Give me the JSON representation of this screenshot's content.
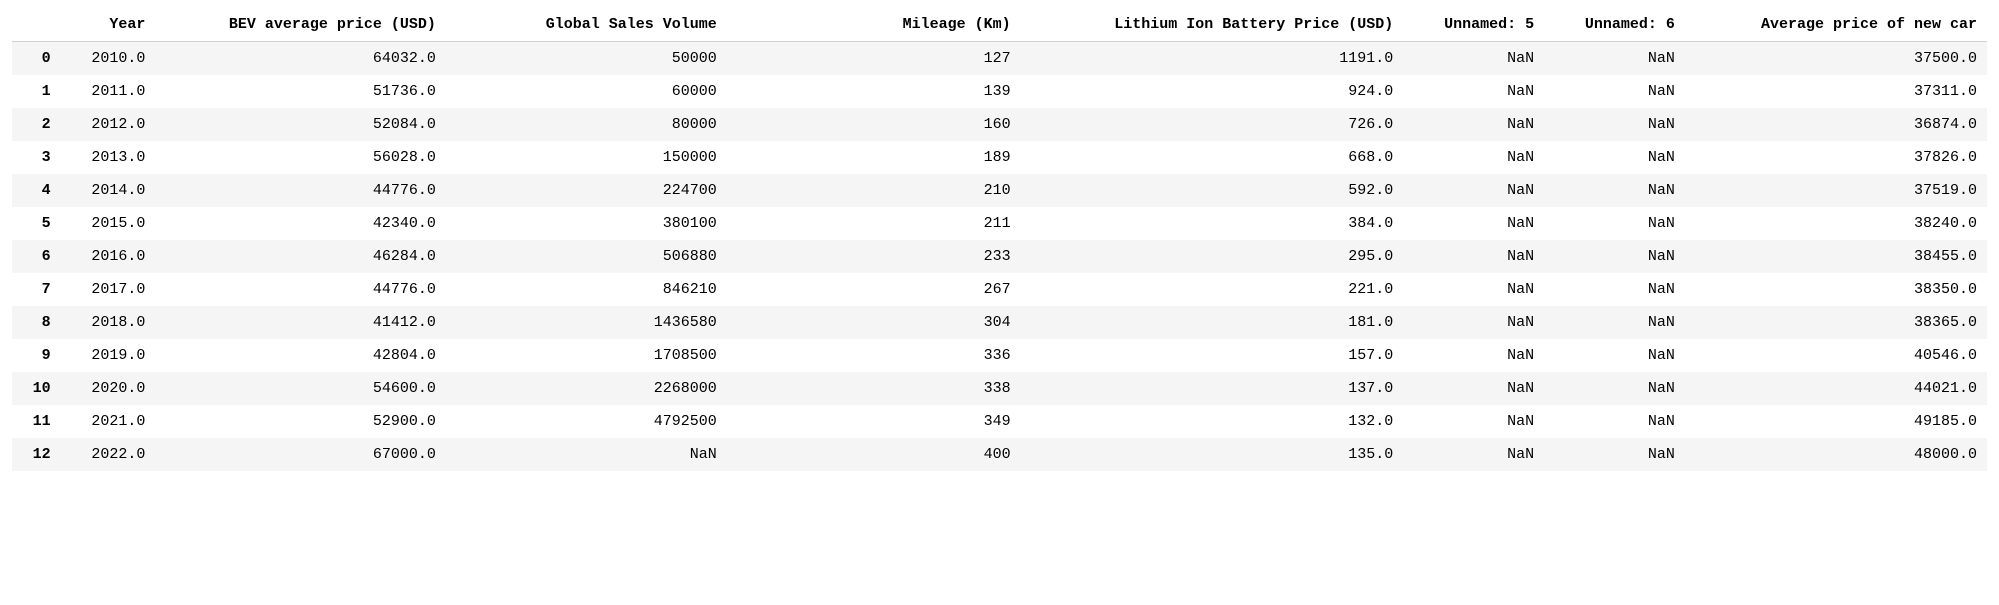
{
  "chart_data": {
    "type": "table",
    "columns": [
      "",
      "Year",
      "BEV average price (USD)",
      "Global Sales Volume",
      "Mileage (Km)",
      "Lithium Ion Battery Price (USD)",
      "Unnamed: 5",
      "Unnamed: 6",
      "Average price of new car"
    ],
    "rows": [
      [
        "0",
        "2010.0",
        "64032.0",
        "50000",
        "127",
        "1191.0",
        "NaN",
        "NaN",
        "37500.0"
      ],
      [
        "1",
        "2011.0",
        "51736.0",
        "60000",
        "139",
        "924.0",
        "NaN",
        "NaN",
        "37311.0"
      ],
      [
        "2",
        "2012.0",
        "52084.0",
        "80000",
        "160",
        "726.0",
        "NaN",
        "NaN",
        "36874.0"
      ],
      [
        "3",
        "2013.0",
        "56028.0",
        "150000",
        "189",
        "668.0",
        "NaN",
        "NaN",
        "37826.0"
      ],
      [
        "4",
        "2014.0",
        "44776.0",
        "224700",
        "210",
        "592.0",
        "NaN",
        "NaN",
        "37519.0"
      ],
      [
        "5",
        "2015.0",
        "42340.0",
        "380100",
        "211",
        "384.0",
        "NaN",
        "NaN",
        "38240.0"
      ],
      [
        "6",
        "2016.0",
        "46284.0",
        "506880",
        "233",
        "295.0",
        "NaN",
        "NaN",
        "38455.0"
      ],
      [
        "7",
        "2017.0",
        "44776.0",
        "846210",
        "267",
        "221.0",
        "NaN",
        "NaN",
        "38350.0"
      ],
      [
        "8",
        "2018.0",
        "41412.0",
        "1436580",
        "304",
        "181.0",
        "NaN",
        "NaN",
        "38365.0"
      ],
      [
        "9",
        "2019.0",
        "42804.0",
        "1708500",
        "336",
        "157.0",
        "NaN",
        "NaN",
        "40546.0"
      ],
      [
        "10",
        "2020.0",
        "54600.0",
        "2268000",
        "338",
        "137.0",
        "NaN",
        "NaN",
        "44021.0"
      ],
      [
        "11",
        "2021.0",
        "52900.0",
        "4792500",
        "349",
        "132.0",
        "NaN",
        "NaN",
        "49185.0"
      ],
      [
        "12",
        "2022.0",
        "67000.0",
        "NaN",
        "400",
        "135.0",
        "NaN",
        "NaN",
        "48000.0"
      ]
    ]
  }
}
